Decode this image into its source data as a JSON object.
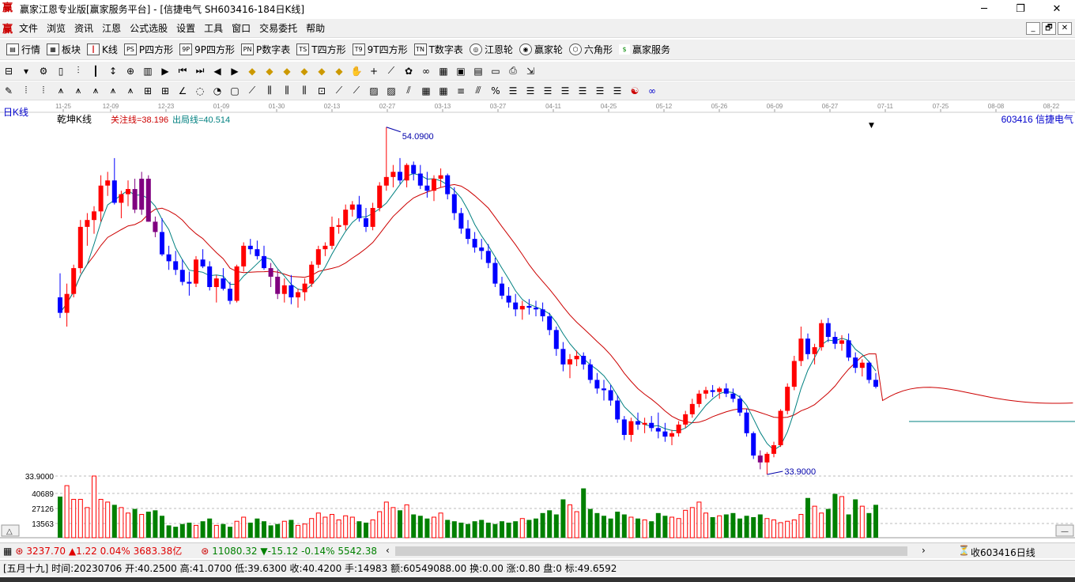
{
  "window": {
    "title": "赢家江恩专业版[赢家服务平台] - [信捷电气  SH603416-184日K线]",
    "app_icon": "赢",
    "minimize": "─",
    "maximize": "❐",
    "close": "✕"
  },
  "menu": {
    "items": [
      "文件",
      "浏览",
      "资讯",
      "江恩",
      "公式选股",
      "设置",
      "工具",
      "窗口",
      "交易委托",
      "帮助"
    ],
    "mdi": [
      "_",
      "🗗",
      "✕"
    ]
  },
  "toolbar": {
    "items": [
      {
        "icon": "quotes-icon",
        "label": "行情"
      },
      {
        "icon": "sector-icon",
        "label": "板块"
      },
      {
        "icon": "kline-icon",
        "label": "K线"
      },
      {
        "icon": "p-square-icon",
        "label": "P四方形"
      },
      {
        "icon": "9p-square-icon",
        "label": "9P四方形"
      },
      {
        "icon": "p-number-icon",
        "label": "P数字表"
      },
      {
        "icon": "t-square-icon",
        "label": "T四方形"
      },
      {
        "icon": "9t-square-icon",
        "label": "9T四方形"
      },
      {
        "icon": "t-number-icon",
        "label": "T数字表"
      },
      {
        "icon": "gann-wheel-icon",
        "label": "江恩轮"
      },
      {
        "icon": "winner-wheel-icon",
        "label": "赢家轮"
      },
      {
        "icon": "hexagon-icon",
        "label": "六角形"
      },
      {
        "icon": "dollar-icon",
        "label": "赢家服务"
      }
    ]
  },
  "chart": {
    "period_label": "日K线",
    "indicator_name": "乾坤K线",
    "watch_line": "关注线=38.196",
    "exit_line": "出局线=40.514",
    "stock_label": "603416  信捷电气",
    "high_marker": "54.0900",
    "low_marker": "33.9000",
    "colors": {
      "up": "#ff0000",
      "down": "#0000ff",
      "neutral": "#800080",
      "ma_fast": "#008080",
      "ma_slow": "#cc0000",
      "vol_up": "#ff0000",
      "vol_down": "#008000"
    }
  },
  "chart_data": {
    "type": "candlestick",
    "date_ticks": [
      "11-25",
      "12-09",
      "12-23",
      "01-09",
      "01-30",
      "02-13",
      "02-27",
      "03-13",
      "03-27",
      "04-11",
      "04-25",
      "05-12",
      "05-26",
      "06-09",
      "06-27",
      "07-11",
      "07-25",
      "08-08",
      "08-22"
    ],
    "price_high": 54.09,
    "price_low": 33.9,
    "volume_ticks": [
      "33.9000",
      "40689",
      "27126",
      "13563"
    ],
    "ohlc": [
      [
        44.2,
        45.6,
        43.0,
        43.3
      ],
      [
        43.3,
        45.0,
        42.5,
        44.4
      ],
      [
        44.4,
        46.1,
        44.2,
        45.9
      ],
      [
        45.9,
        48.7,
        45.6,
        48.3
      ],
      [
        48.3,
        49.1,
        47.2,
        48.7
      ],
      [
        48.7,
        49.5,
        47.9,
        49.2
      ],
      [
        49.2,
        51.3,
        48.6,
        50.7
      ],
      [
        50.7,
        51.5,
        50.1,
        51.0
      ],
      [
        51.0,
        52.3,
        49.6,
        49.7
      ],
      [
        49.7,
        50.4,
        48.8,
        50.2
      ],
      [
        50.2,
        51.0,
        49.5,
        50.5
      ],
      [
        50.5,
        51.1,
        49.1,
        49.3
      ],
      [
        49.3,
        51.5,
        49.0,
        51.1
      ],
      [
        51.1,
        51.3,
        48.6,
        48.6
      ],
      [
        48.6,
        48.9,
        47.7,
        48.0
      ],
      [
        48.0,
        48.8,
        46.6,
        46.7
      ],
      [
        46.7,
        47.2,
        45.8,
        46.3
      ],
      [
        46.3,
        46.9,
        45.5,
        45.8
      ],
      [
        45.8,
        46.4,
        44.9,
        45.1
      ],
      [
        45.1,
        45.7,
        44.3,
        45.0
      ],
      [
        45.0,
        46.6,
        44.8,
        46.4
      ],
      [
        46.4,
        47.0,
        45.9,
        46.0
      ],
      [
        46.0,
        46.3,
        44.6,
        44.8
      ],
      [
        44.8,
        45.5,
        43.9,
        45.3
      ],
      [
        45.3,
        45.9,
        44.6,
        44.7
      ],
      [
        44.7,
        45.1,
        43.8,
        44.0
      ],
      [
        44.0,
        46.1,
        43.9,
        46.0
      ],
      [
        46.0,
        47.4,
        45.7,
        47.2
      ],
      [
        47.2,
        47.6,
        46.7,
        47.0
      ],
      [
        47.0,
        47.5,
        46.4,
        46.6
      ],
      [
        46.6,
        47.2,
        45.8,
        45.9
      ],
      [
        45.9,
        46.2,
        44.8,
        45.4
      ],
      [
        45.4,
        45.8,
        44.1,
        44.4
      ],
      [
        44.4,
        45.3,
        43.9,
        44.9
      ],
      [
        44.9,
        45.5,
        43.8,
        44.2
      ],
      [
        44.2,
        44.7,
        43.6,
        44.5
      ],
      [
        44.5,
        45.3,
        44.0,
        45.0
      ],
      [
        45.0,
        46.3,
        44.8,
        46.1
      ],
      [
        46.1,
        47.2,
        45.9,
        47.0
      ],
      [
        47.0,
        47.4,
        46.6,
        47.2
      ],
      [
        47.2,
        48.9,
        47.0,
        48.3
      ],
      [
        48.3,
        48.8,
        47.9,
        48.4
      ],
      [
        48.4,
        49.6,
        48.1,
        49.3
      ],
      [
        49.3,
        49.8,
        48.9,
        49.6
      ],
      [
        49.6,
        50.1,
        48.6,
        48.8
      ],
      [
        48.8,
        49.4,
        48.0,
        48.3
      ],
      [
        48.3,
        49.7,
        48.1,
        49.4
      ],
      [
        49.4,
        50.9,
        49.2,
        50.7
      ],
      [
        50.7,
        54.1,
        50.4,
        51.2
      ],
      [
        51.2,
        51.9,
        50.6,
        51.5
      ],
      [
        51.5,
        52.3,
        50.8,
        51.0
      ],
      [
        51.0,
        52.0,
        50.6,
        51.9
      ],
      [
        51.9,
        52.1,
        51.0,
        51.4
      ],
      [
        51.4,
        51.9,
        50.5,
        50.7
      ],
      [
        50.7,
        51.5,
        50.0,
        50.4
      ],
      [
        50.4,
        51.3,
        49.8,
        51.1
      ],
      [
        51.1,
        51.7,
        50.6,
        51.3
      ],
      [
        51.3,
        51.4,
        49.9,
        50.2
      ],
      [
        50.2,
        50.6,
        48.7,
        49.1
      ],
      [
        49.1,
        49.4,
        47.9,
        48.2
      ],
      [
        48.2,
        48.7,
        47.3,
        47.6
      ],
      [
        47.6,
        48.0,
        46.8,
        47.1
      ],
      [
        47.1,
        47.6,
        46.4,
        46.9
      ],
      [
        46.9,
        47.3,
        45.9,
        46.2
      ],
      [
        46.2,
        46.5,
        44.8,
        45.0
      ],
      [
        45.0,
        45.4,
        44.1,
        44.3
      ],
      [
        44.3,
        44.8,
        43.6,
        43.9
      ],
      [
        43.9,
        44.4,
        43.1,
        43.5
      ],
      [
        43.5,
        44.0,
        42.9,
        43.7
      ],
      [
        43.7,
        44.1,
        43.2,
        43.6
      ],
      [
        43.6,
        44.0,
        43.1,
        43.5
      ],
      [
        43.5,
        43.9,
        42.8,
        43.1
      ],
      [
        43.1,
        43.3,
        42.0,
        42.3
      ],
      [
        42.3,
        42.5,
        40.8,
        41.2
      ],
      [
        41.2,
        41.6,
        39.9,
        40.3
      ],
      [
        40.3,
        40.9,
        39.5,
        40.6
      ],
      [
        40.6,
        41.1,
        40.2,
        40.8
      ],
      [
        40.8,
        41.0,
        40.0,
        40.3
      ],
      [
        40.3,
        40.6,
        39.2,
        39.4
      ],
      [
        39.4,
        39.8,
        38.6,
        38.9
      ],
      [
        38.9,
        39.4,
        38.2,
        38.8
      ],
      [
        38.8,
        39.1,
        37.9,
        38.2
      ],
      [
        38.2,
        38.5,
        36.9,
        37.1
      ],
      [
        37.1,
        37.3,
        35.9,
        36.2
      ],
      [
        36.2,
        37.2,
        35.8,
        37.0
      ],
      [
        37.0,
        37.5,
        36.5,
        36.8
      ],
      [
        36.8,
        37.2,
        36.3,
        36.9
      ],
      [
        36.9,
        37.3,
        36.4,
        36.6
      ],
      [
        36.6,
        37.5,
        36.0,
        36.4
      ],
      [
        36.4,
        36.9,
        35.8,
        36.1
      ],
      [
        36.1,
        36.5,
        35.6,
        36.3
      ],
      [
        36.3,
        37.0,
        36.1,
        36.8
      ],
      [
        36.8,
        37.6,
        36.6,
        37.4
      ],
      [
        37.4,
        38.3,
        37.2,
        38.0
      ],
      [
        38.0,
        38.8,
        37.8,
        38.6
      ],
      [
        38.6,
        39.0,
        38.3,
        38.8
      ],
      [
        38.8,
        39.1,
        38.4,
        38.7
      ],
      [
        38.7,
        39.0,
        38.3,
        38.9
      ],
      [
        38.9,
        39.2,
        38.4,
        38.6
      ],
      [
        38.6,
        38.9,
        38.1,
        38.3
      ],
      [
        38.3,
        38.5,
        37.3,
        37.5
      ],
      [
        37.5,
        37.7,
        36.1,
        36.3
      ],
      [
        36.3,
        36.4,
        34.8,
        35.0
      ],
      [
        35.0,
        35.3,
        34.2,
        34.6
      ],
      [
        34.6,
        35.2,
        33.9,
        35.1
      ],
      [
        35.1,
        35.8,
        34.9,
        35.6
      ],
      [
        35.6,
        37.7,
        35.5,
        37.6
      ],
      [
        37.6,
        39.2,
        37.4,
        39.0
      ],
      [
        39.0,
        40.8,
        38.8,
        40.5
      ],
      [
        40.5,
        42.5,
        40.2,
        41.8
      ],
      [
        41.8,
        42.1,
        40.6,
        40.9
      ],
      [
        40.9,
        41.5,
        40.3,
        41.3
      ],
      [
        41.3,
        42.9,
        41.1,
        42.7
      ],
      [
        42.7,
        43.0,
        41.6,
        41.9
      ],
      [
        41.9,
        42.2,
        41.2,
        41.5
      ],
      [
        41.5,
        42.0,
        41.1,
        41.7
      ],
      [
        41.7,
        42.1,
        40.5,
        40.7
      ],
      [
        40.7,
        41.0,
        39.8,
        40.1
      ],
      [
        40.1,
        40.6,
        39.6,
        40.4
      ],
      [
        40.4,
        40.5,
        39.2,
        39.4
      ],
      [
        39.4,
        39.8,
        38.9,
        39.0
      ]
    ],
    "volume": [
      30,
      38,
      28,
      28,
      22,
      45,
      28,
      26,
      24,
      22,
      18,
      21,
      17,
      19,
      20,
      16,
      9,
      8,
      10,
      11,
      9,
      12,
      14,
      9,
      10,
      8,
      12,
      15,
      11,
      14,
      12,
      9,
      10,
      12,
      13,
      9,
      10,
      14,
      18,
      15,
      17,
      13,
      16,
      15,
      12,
      11,
      13,
      19,
      26,
      22,
      20,
      24,
      17,
      16,
      14,
      15,
      18,
      13,
      12,
      11,
      10,
      12,
      13,
      11,
      10,
      12,
      11,
      12,
      14,
      13,
      14,
      18,
      20,
      17,
      28,
      24,
      19,
      36,
      21,
      18,
      16,
      14,
      19,
      17,
      15,
      14,
      13,
      12,
      18,
      16,
      15,
      14,
      20,
      22,
      26,
      18,
      15,
      16,
      17,
      18,
      14,
      16,
      15,
      17,
      14,
      13,
      11,
      12,
      13,
      17,
      29,
      23,
      18,
      21,
      32,
      30,
      17,
      28,
      23,
      18,
      24,
      21,
      19,
      15,
      18,
      21,
      23,
      20
    ],
    "ma_fast_note": "teal line follows closes",
    "ma_slow_note": "red smoothed line"
  },
  "status": {
    "sh_index": "3237.70",
    "sh_change": "▲1.22 0.04%",
    "sh_amount": "3683.38亿",
    "sz_index": "11080.32",
    "sz_change": "▼-15.12 -0.14%",
    "sz_amount": "5542.38",
    "right_label": "收603416日线"
  },
  "info": {
    "text": "[五月十九] 时间:20230706 开:40.2500 高:41.0700 低:39.6300 收:40.4200 手:14983 额:60549088.00 换:0.00 涨:0.80 盘:0 标:49.6592"
  }
}
